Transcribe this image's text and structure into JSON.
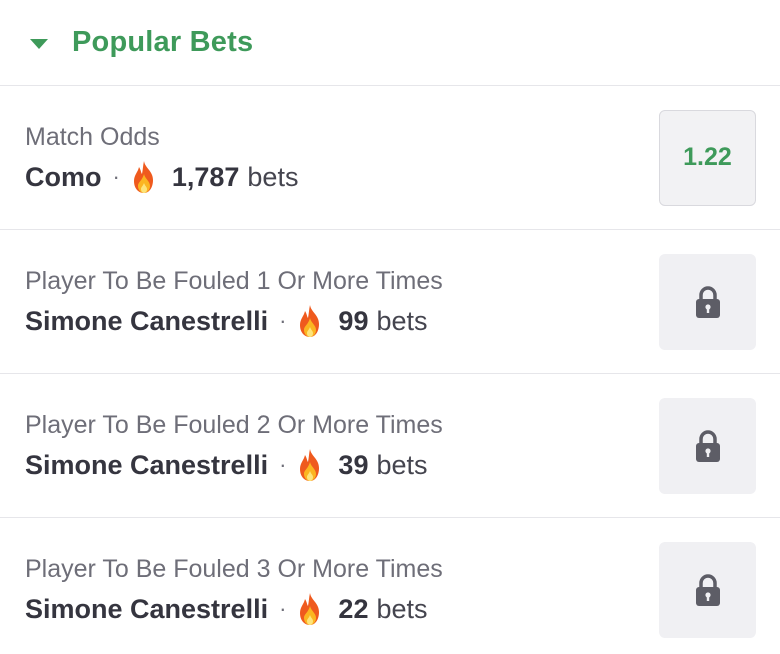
{
  "header": {
    "title": "Popular Bets",
    "icon": "caret-down-icon",
    "accent_color": "#3e9a5a"
  },
  "bets": [
    {
      "market": "Match Odds",
      "selection": "Como",
      "separator": "·",
      "count": "1,787",
      "bets_word": "bets",
      "odds": "1.22",
      "locked": false
    },
    {
      "market": "Player To Be Fouled 1 Or More Times",
      "selection": "Simone Canestrelli",
      "separator": "·",
      "count": "99",
      "bets_word": "bets",
      "locked": true
    },
    {
      "market": "Player To Be Fouled 2 Or More Times",
      "selection": "Simone Canestrelli",
      "separator": "·",
      "count": "39",
      "bets_word": "bets",
      "locked": true
    },
    {
      "market": "Player To Be Fouled 3 Or More Times",
      "selection": "Simone Canestrelli",
      "separator": "·",
      "count": "22",
      "bets_word": "bets",
      "locked": true
    }
  ]
}
